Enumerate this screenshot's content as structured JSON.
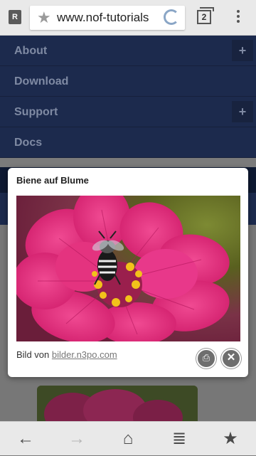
{
  "browser": {
    "url": "www.nof-tutorials",
    "tab_count": "2",
    "reader_icon": "reader-mode-icon",
    "bookmark_icon": "star-icon"
  },
  "nav": {
    "items": [
      {
        "label": "About",
        "has_sub": true
      },
      {
        "label": "Download",
        "has_sub": false
      },
      {
        "label": "Support",
        "has_sub": true
      },
      {
        "label": "Docs",
        "has_sub": false
      }
    ],
    "expand_symbol": "+"
  },
  "lightbox": {
    "title": "Biene auf Blume",
    "caption_prefix": "Bild von",
    "caption_link": "bilder.n3po.com"
  },
  "toolbar": {
    "back": "←",
    "forward": "→",
    "home": "⌂",
    "reading_list": "≣",
    "bookmarks": "★"
  },
  "colors": {
    "nav_bg": "#1c2a4d",
    "flower": "#e0307a",
    "bee_center": "#f2c21a"
  }
}
